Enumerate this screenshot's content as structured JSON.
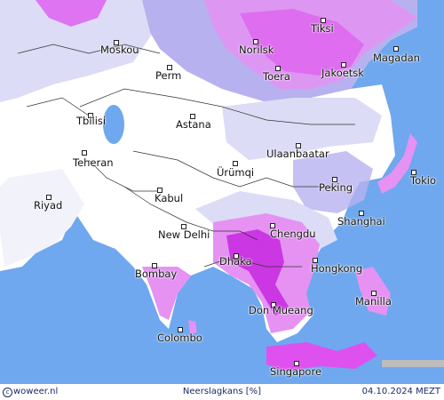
{
  "map": {
    "legend_colors": {
      "ocean": "#6fa8ee",
      "land_zero": "#ffffff",
      "low": "#dcdcf7",
      "medium": "#b7b1ef",
      "high": "#e592f3",
      "very_high": "#df51ef",
      "extreme": "#c82ee0"
    },
    "cities": [
      {
        "name": "Moskou"
      },
      {
        "name": "Norilsk"
      },
      {
        "name": "Tiksi"
      },
      {
        "name": "Magadan"
      },
      {
        "name": "Perm"
      },
      {
        "name": "Toera"
      },
      {
        "name": "Jakoetsk"
      },
      {
        "name": "Tbilisi"
      },
      {
        "name": "Astana"
      },
      {
        "name": "Teheran"
      },
      {
        "name": "Ulaanbaatar"
      },
      {
        "name": "Ürümqi"
      },
      {
        "name": "Riyad"
      },
      {
        "name": "Kabul"
      },
      {
        "name": "Peking"
      },
      {
        "name": "Tokio"
      },
      {
        "name": "Shanghai"
      },
      {
        "name": "New Delhi"
      },
      {
        "name": "Chengdu"
      },
      {
        "name": "Dhaka"
      },
      {
        "name": "Hongkong"
      },
      {
        "name": "Bombay"
      },
      {
        "name": "Manilla"
      },
      {
        "name": "Don Mueang"
      },
      {
        "name": "Colombo"
      },
      {
        "name": "Singapore"
      }
    ]
  },
  "footer": {
    "copyright_symbol": "c",
    "brand": "woweer.nl",
    "variable": "Neerslagkans [%]",
    "datetime": "04.10.2024 MEZT"
  }
}
